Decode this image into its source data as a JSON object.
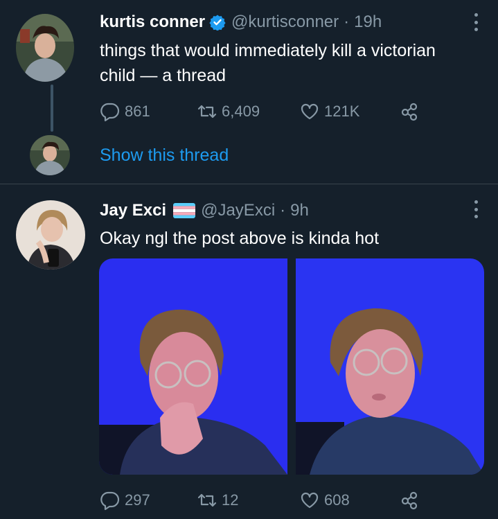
{
  "tweets": [
    {
      "name": "kurtis conner",
      "handle": "@kurtisconner",
      "dot": "·",
      "time": "19h",
      "text": "things that would immediately kill a victorian child — a thread",
      "replies": "861",
      "retweets": "6,409",
      "likes": "121K",
      "show_thread": "Show this thread"
    },
    {
      "name": "Jay Exci",
      "handle": "@JayExci",
      "dot": "·",
      "time": "9h",
      "text": "Okay ngl the post above is kinda hot",
      "replies": "297",
      "retweets": "12",
      "likes": "608"
    }
  ],
  "icons": {
    "reply": "comment-bubble-icon",
    "retweet": "retweet-icon",
    "like": "heart-icon",
    "share": "share-icon",
    "verified": "verified-badge-icon",
    "more": "more-dots-icon"
  },
  "colors": {
    "background": "#15202b",
    "secondary_text": "#8899a6",
    "link": "#1d9bf0",
    "divider": "#38444d"
  }
}
